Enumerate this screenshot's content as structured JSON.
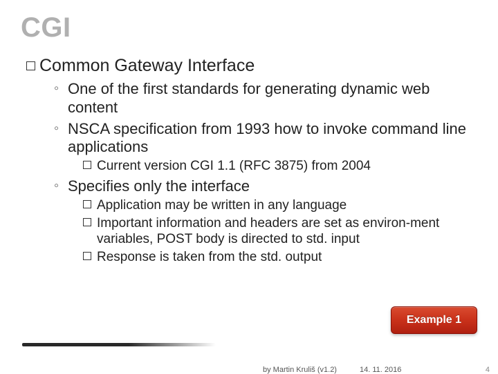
{
  "title": "CGI",
  "heading": "Common Gateway Interface",
  "bullets": [
    {
      "text": "One of the first standards for generating dynamic web content",
      "sub": []
    },
    {
      "text": "NSCA specification from 1993 how to invoke command line applications",
      "sub": [
        "Current version CGI 1.1 (RFC 3875) from 2004"
      ]
    },
    {
      "text": "Specifies only the interface",
      "sub": [
        "Application may be written in any language",
        "Important information and headers are set as environ-ment variables, POST body is directed to std. input",
        "Response is taken from the std. output"
      ]
    }
  ],
  "example_label": "Example 1",
  "footer": {
    "author": "by Martin Kruliš (v1.2)",
    "date": "14. 11. 2016",
    "page": "4"
  }
}
